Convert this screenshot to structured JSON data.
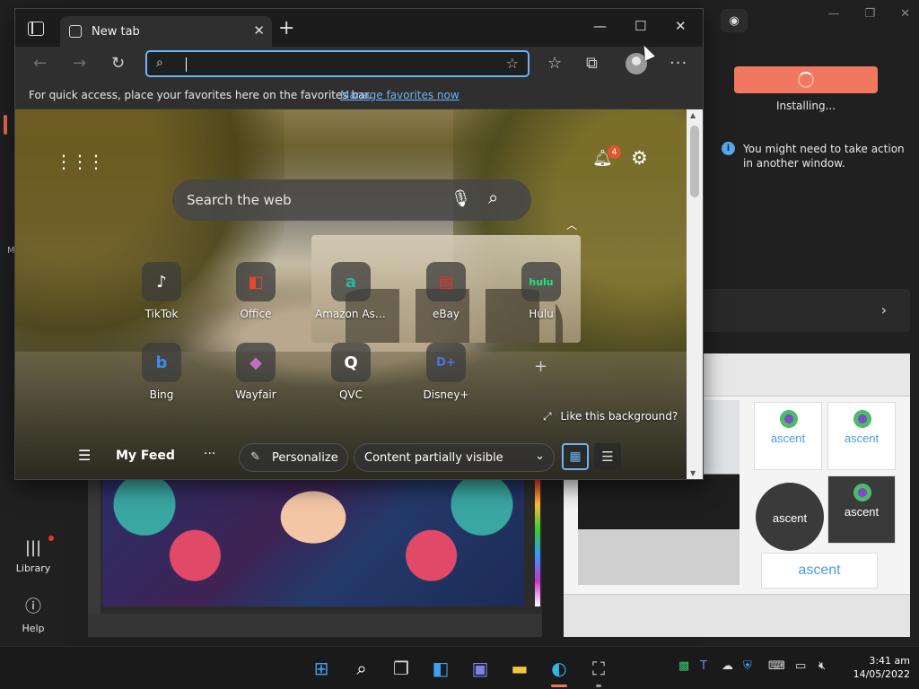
{
  "background_app": {
    "rail": {
      "side_letter": "M",
      "library_label": "Library",
      "help_label": "Help"
    },
    "install": {
      "status": "Installing...",
      "info": "You might need to take action in another window."
    },
    "art_right_logos": [
      "ascent",
      "ascent",
      "ascent",
      "ascent",
      "ascent"
    ],
    "accent_color": "#f07860"
  },
  "edge": {
    "tab": {
      "title": "New tab"
    },
    "address": {
      "value": "",
      "placeholder": ""
    },
    "favorites_bar": {
      "message": "For quick access, place your favorites here on the favorites bar.",
      "link": "Manage favorites now"
    },
    "ntp": {
      "notifications_count": "4",
      "search_placeholder": "Search the web",
      "quick_links": [
        {
          "label": "TikTok",
          "icon": "tiktok-logo",
          "glyph": "♪",
          "color": "#ffffff"
        },
        {
          "label": "Office",
          "icon": "office-logo",
          "glyph": "◧",
          "color": "#e3472f"
        },
        {
          "label": "Amazon Assi...",
          "icon": "amazon-logo",
          "glyph": "a",
          "color": "#2bb5a0"
        },
        {
          "label": "eBay",
          "icon": "ebay-logo",
          "glyph": "▤",
          "color": "#e5302e"
        },
        {
          "label": "Hulu",
          "icon": "hulu-logo",
          "glyph": "hulu",
          "color": "#1ce783"
        },
        {
          "label": "Bing",
          "icon": "bing-logo",
          "glyph": "b",
          "color": "#3a8ee6"
        },
        {
          "label": "Wayfair",
          "icon": "wayfair-logo",
          "glyph": "◆",
          "color": "#c56ac8"
        },
        {
          "label": "QVC",
          "icon": "qvc-logo",
          "glyph": "Q",
          "color": "#ffffff"
        },
        {
          "label": "Disney+",
          "icon": "disney-plus-logo",
          "glyph": "D+",
          "color": "#4b73e6"
        }
      ],
      "like_background": "Like this background?",
      "feed": {
        "title": "My Feed",
        "personalize": "Personalize",
        "content_visibility": "Content partially visible"
      }
    }
  },
  "taskbar": {
    "time": "3:41 am",
    "date": "14/05/2022"
  }
}
